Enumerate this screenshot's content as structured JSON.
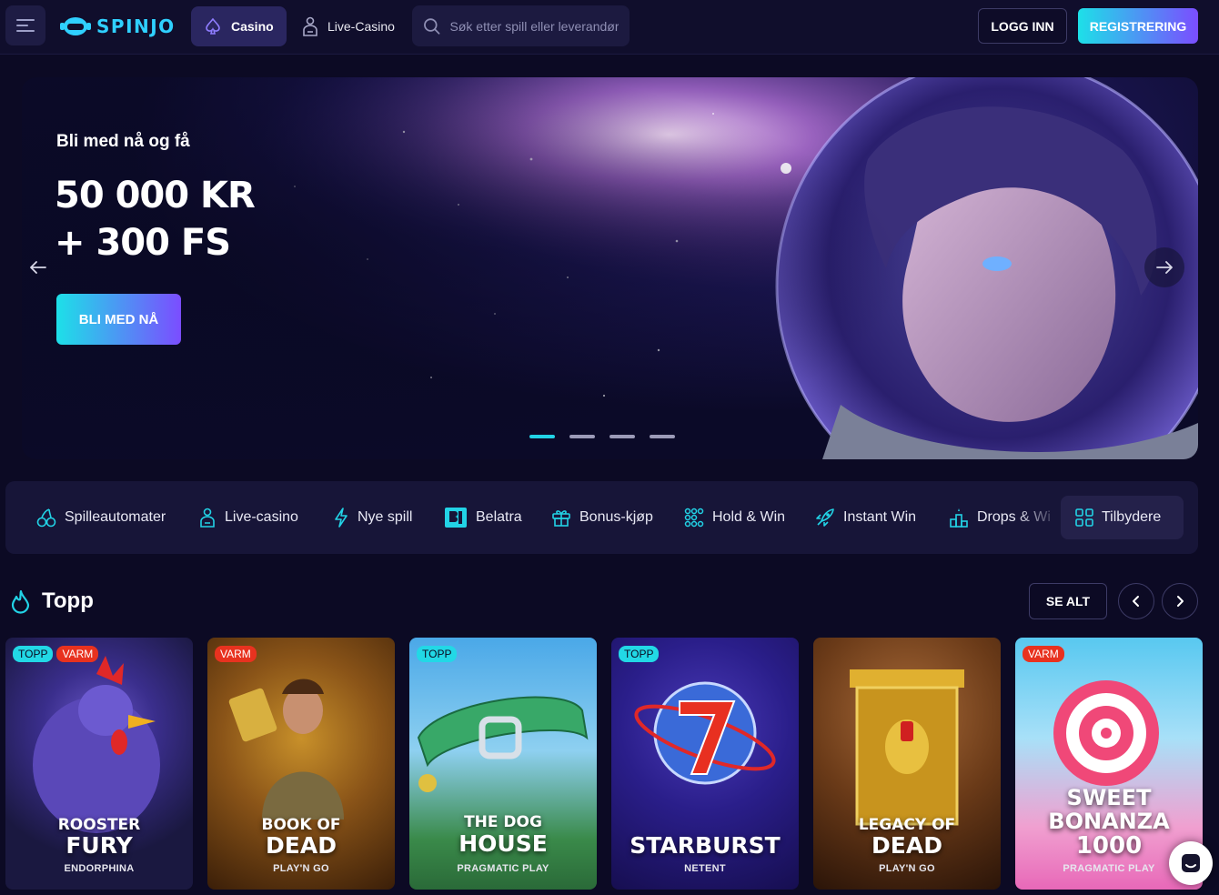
{
  "header": {
    "logo_text": "SPINJO",
    "tabs": [
      {
        "label": "Casino",
        "icon": "spade-icon",
        "active": true
      },
      {
        "label": "Live-Casino",
        "icon": "dealer-icon",
        "active": false
      }
    ],
    "search_placeholder": "Søk etter spill eller leverandør",
    "login_label": "LOGG INN",
    "register_label": "REGISTRERING"
  },
  "hero": {
    "kicker": "Bli med nå og få",
    "amount_line1": "50 000 KR",
    "amount_line2": "+ 300 FS",
    "cta_label": "BLI MED NÅ",
    "slides": 4,
    "active_slide": 0
  },
  "categories": [
    {
      "label": "Spilleautomater",
      "icon": "cherries-icon"
    },
    {
      "label": "Live-casino",
      "icon": "dealer-icon"
    },
    {
      "label": "Nye spill",
      "icon": "lightning-icon"
    },
    {
      "label": "Belatra",
      "icon": "belatra-logo-icon"
    },
    {
      "label": "Bonus-kjøp",
      "icon": "gift-icon"
    },
    {
      "label": "Hold & Win",
      "icon": "grid-dots-icon"
    },
    {
      "label": "Instant Win",
      "icon": "rocket-icon"
    },
    {
      "label": "Drops & Wi",
      "icon": "podium-icon"
    },
    {
      "label": "Tilbydere",
      "icon": "grid-icon"
    }
  ],
  "section": {
    "title": "Topp",
    "see_all_label": "SE ALT"
  },
  "games": [
    {
      "t1": "ROOSTER",
      "t2": "FURY",
      "provider": "ENDORPHINA",
      "badges": [
        "TOPP",
        "VARM"
      ]
    },
    {
      "t1": "BOOK OF",
      "t2": "DEAD",
      "provider": "PLAY'N GO",
      "badges": [
        "VARM"
      ]
    },
    {
      "t1": "THE DOG",
      "t2": "HOUSE",
      "provider": "PRAGMATIC PLAY",
      "badges": [
        "TOPP"
      ]
    },
    {
      "t1": "",
      "t2": "STARBURST",
      "provider": "NETENT",
      "badges": [
        "TOPP"
      ]
    },
    {
      "t1": "LEGACY OF",
      "t2": "DEAD",
      "provider": "PLAY'N GO",
      "badges": []
    },
    {
      "t1": "SWEET",
      "t2": "BONANZA",
      "t3": "1000",
      "provider": "PRAGMATIC PLAY",
      "badges": [
        "VARM"
      ]
    }
  ],
  "colors": {
    "accent_cyan": "#1de0e8",
    "accent_purple": "#7b4dff",
    "background": "#0c0a24",
    "badge_top": "#22d8e6",
    "badge_hot": "#e8321f"
  }
}
